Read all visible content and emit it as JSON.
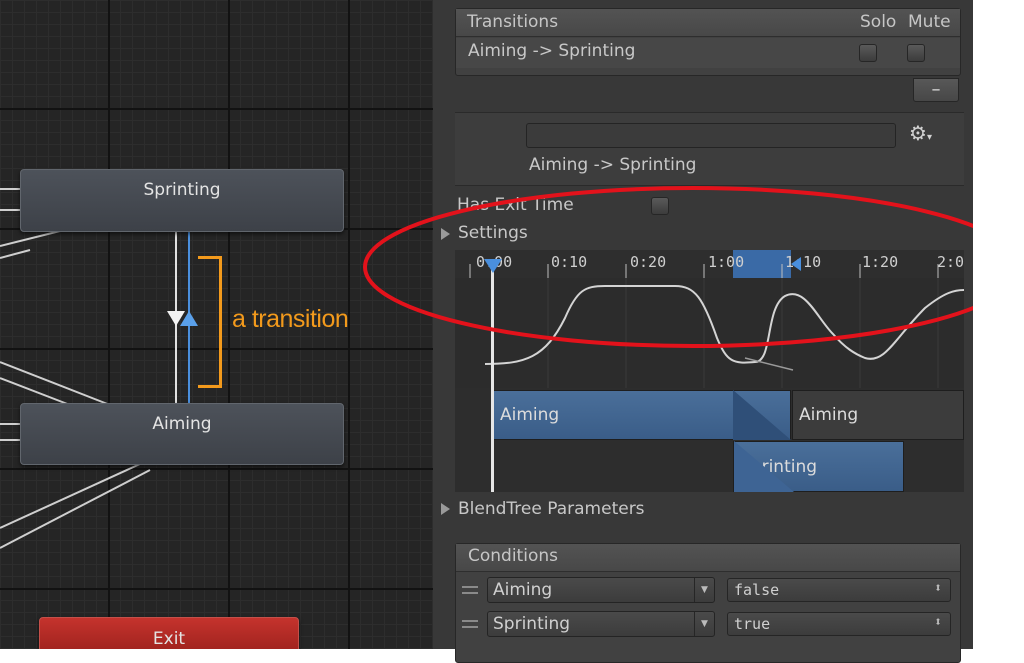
{
  "graph": {
    "states": [
      {
        "name": "Sprinting"
      },
      {
        "name": "Aiming"
      },
      {
        "name": "Exit"
      }
    ],
    "annotation": "a transition",
    "colors": {
      "annotation": "#f39a1c",
      "selected_transition": "#4a8fdd",
      "exit_state": "#b22b25"
    }
  },
  "inspector": {
    "transitions_header": "Transitions",
    "solo_label": "Solo",
    "mute_label": "Mute",
    "transition_row": "Aiming -> Sprinting",
    "remove_button": "–",
    "name_field_value": "",
    "subtitle": "Aiming -> Sprinting",
    "has_exit_time_label": "Has Exit Time",
    "settings_label": "Settings",
    "timeline": {
      "ticks": [
        "0:00",
        "0:10",
        "0:20",
        "1:00",
        "1:10",
        "1:20",
        "2:0"
      ],
      "source_clip": "Aiming",
      "next_clip": "Aiming",
      "target_clip": "Sprinting"
    },
    "blendtree_label": "BlendTree Parameters",
    "conditions_header": "Conditions",
    "conditions": [
      {
        "parameter": "Aiming",
        "value": "false"
      },
      {
        "parameter": "Sprinting",
        "value": "true"
      }
    ]
  }
}
